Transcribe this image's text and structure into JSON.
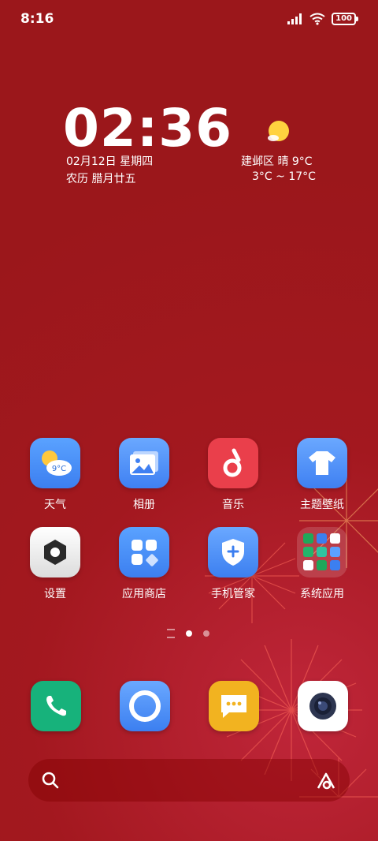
{
  "status_bar": {
    "time": "8:16",
    "battery": "100"
  },
  "widget": {
    "clock": "02:36",
    "date_line": "02月12日  星期四",
    "lunar_line": "农历  腊月廿五",
    "weather_line": "建邺区  晴  9°C",
    "range_line": "3°C ~ 17°C"
  },
  "apps": [
    {
      "label": "天气",
      "badge": "9°C",
      "icon": "weather-icon"
    },
    {
      "label": "相册",
      "icon": "gallery-icon"
    },
    {
      "label": "音乐",
      "icon": "music-icon"
    },
    {
      "label": "主题壁纸",
      "icon": "theme-icon"
    },
    {
      "label": "设置",
      "icon": "settings-icon"
    },
    {
      "label": "应用商店",
      "icon": "app-store-icon"
    },
    {
      "label": "手机管家",
      "icon": "phone-manager-icon"
    },
    {
      "label": "系统应用",
      "icon": "system-apps-folder-icon"
    }
  ],
  "dock": [
    {
      "icon": "phone-icon"
    },
    {
      "icon": "browser-icon"
    },
    {
      "icon": "messages-icon"
    },
    {
      "icon": "camera-icon"
    }
  ],
  "colors": {
    "background": "#9b171b",
    "weather": "#4a8ff2",
    "music": "#ea3f4b",
    "phone": "#17b27b",
    "messages": "#f2b320"
  }
}
